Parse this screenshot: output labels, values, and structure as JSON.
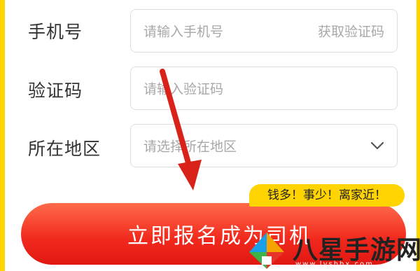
{
  "form": {
    "phone": {
      "label": "手机号",
      "placeholder": "请输入手机号",
      "action": "获取验证码"
    },
    "code": {
      "label": "验证码",
      "placeholder": "请输入验证码"
    },
    "region": {
      "label": "所在地区",
      "placeholder": "请选择所在地区"
    }
  },
  "cta": {
    "label": "立即报名成为司机",
    "badge": "钱多！事少！离家近！"
  },
  "watermark": {
    "name": "八星手游网",
    "url": "www.lyshbx.com"
  },
  "colors": {
    "accent": "#f0281c",
    "badge": "#ffd400",
    "annotation_arrow": "#d9231a"
  }
}
